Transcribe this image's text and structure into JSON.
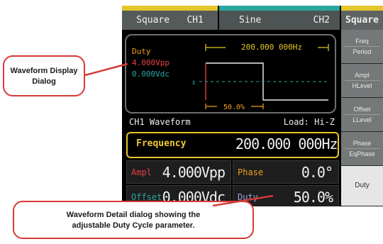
{
  "channel_tabs": [
    {
      "wave": "Square",
      "channel": "CH1",
      "color": "#e3c62a"
    },
    {
      "wave": "Sine",
      "channel": "CH2",
      "color": "#2aa6a0"
    }
  ],
  "waveform_display": {
    "duty_label": "Duty",
    "amplitude": "4.000Vpp",
    "offset": "0.000Vdc",
    "frequency_marker": "200.000 000Hz",
    "duty_marker": "50.0%"
  },
  "menu": {
    "title": "Square",
    "items": [
      {
        "label": "Freq",
        "sub": "Period"
      },
      {
        "label": "Ampl",
        "sub": "HLevel"
      },
      {
        "label": "Offset",
        "sub": "LLevel"
      },
      {
        "label": "Phase",
        "sub": "EqPhase"
      },
      {
        "label": "Duty",
        "sub": ""
      }
    ]
  },
  "detail": {
    "title": "CH1 Waveform",
    "load": "Load: Hi-Z",
    "frequency": {
      "label": "Frequency",
      "value": "200.000 000Hz"
    },
    "ampl": {
      "label": "Ampl",
      "value": "4.000Vpp"
    },
    "phase": {
      "label": "Phase",
      "value": "0.0°"
    },
    "offset": {
      "label": "Offset",
      "value": "0.000Vdc"
    },
    "duty": {
      "label": "Duty",
      "value": "50.0%"
    }
  },
  "callouts": {
    "display": [
      "Waveform Display",
      "Dialog"
    ],
    "detail": [
      "Waveform Detail dialog showing the",
      "adjustable Duty Cycle parameter."
    ]
  },
  "colors": {
    "ch1": "#e3c62a",
    "ch2": "#2aa6a0",
    "duty_orange": "#f0a020",
    "amp_red": "#e84040",
    "callout_border": "#d73a37"
  }
}
